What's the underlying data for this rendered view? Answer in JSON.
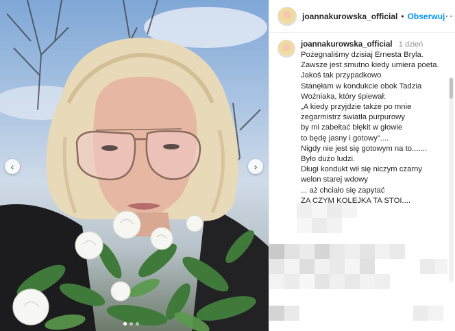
{
  "post": {
    "username": "joannakurowska_official",
    "follow_label": "Obserwuj",
    "separator": "•",
    "more_icon": "more-icon"
  },
  "caption": {
    "username": "joannakurowska_official",
    "time": "1 dzień",
    "lines": [
      "Pożegnaliśmy dzisiaj Ernesta Bryla.",
      "Zawsze jest smutno kiedy umiera poeta.",
      "Jakoś tak przypadkowo",
      "Stanęłam w kondukcie obok Tadzia",
      "Woźniaka, który śpiewał:",
      "„A kiedy przyjdzie także po mnie",
      "zegarmistrz światła purpurowy",
      "by mi zabełtać błękit w głowie",
      "to będę jasny i gotowy”....",
      "Nigdy nie jest się gotowym na to.......",
      "Było dużo ludzi.",
      "Długi kondukt wił się niczym czarny",
      "welon starej wdowy",
      "... aż chciało się zapytać",
      "ZA CZYM KOLEJKA TA STOI...."
    ]
  },
  "carousel": {
    "prev_icon": "‹",
    "next_icon": "›",
    "slide_count": 3,
    "active_slide": 1
  },
  "colors": {
    "link": "#0095f6",
    "muted": "#8e8e8e",
    "text": "#262626"
  }
}
